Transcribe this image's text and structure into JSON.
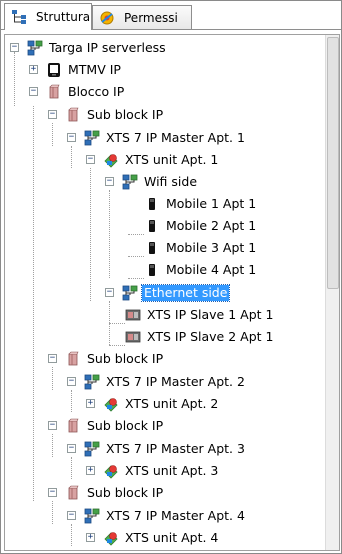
{
  "tabs": [
    {
      "label": "Struttura",
      "icon": "structure-icon",
      "active": true
    },
    {
      "label": "Permessi",
      "icon": "permissions-icon",
      "active": false
    }
  ],
  "tree": {
    "nodes": [
      {
        "label": "Targa IP serverless",
        "icon": "network-icon"
      },
      {
        "label": "MTMV IP",
        "icon": "monitor-device-icon"
      },
      {
        "label": "Blocco IP",
        "icon": "building-block-icon"
      },
      {
        "label": "Sub block IP",
        "icon": "building-block-icon"
      },
      {
        "label": "XTS 7 IP Master Apt. 1",
        "icon": "network-icon"
      },
      {
        "label": "XTS unit Apt. 1",
        "icon": "unit-icon"
      },
      {
        "label": "Wifi side",
        "icon": "network-icon"
      },
      {
        "label": "Mobile 1 Apt 1",
        "icon": "mobile-icon"
      },
      {
        "label": "Mobile 2 Apt 1",
        "icon": "mobile-icon"
      },
      {
        "label": "Mobile 3 Apt 1",
        "icon": "mobile-icon"
      },
      {
        "label": "Mobile 4 Apt 1",
        "icon": "mobile-icon"
      },
      {
        "label": "Ethernet side",
        "icon": "network-icon",
        "selected": true
      },
      {
        "label": "XTS IP Slave 1 Apt 1",
        "icon": "slave-device-icon"
      },
      {
        "label": "XTS IP Slave 2 Apt 1",
        "icon": "slave-device-icon"
      },
      {
        "label": "Sub block IP",
        "icon": "building-block-icon"
      },
      {
        "label": "XTS 7 IP Master Apt. 2",
        "icon": "network-icon"
      },
      {
        "label": "XTS unit Apt. 2",
        "icon": "unit-icon"
      },
      {
        "label": "Sub block IP",
        "icon": "building-block-icon"
      },
      {
        "label": "XTS 7 IP Master Apt. 3",
        "icon": "network-icon"
      },
      {
        "label": "XTS unit Apt. 3",
        "icon": "unit-icon"
      },
      {
        "label": "Sub block IP",
        "icon": "building-block-icon"
      },
      {
        "label": "XTS 7 IP Master Apt. 4",
        "icon": "network-icon"
      },
      {
        "label": "XTS unit Apt. 4",
        "icon": "unit-icon"
      }
    ]
  },
  "colors": {
    "selection": "#3399ff",
    "tree_lines": "#a0a0a0",
    "border": "#8e8e8e"
  }
}
